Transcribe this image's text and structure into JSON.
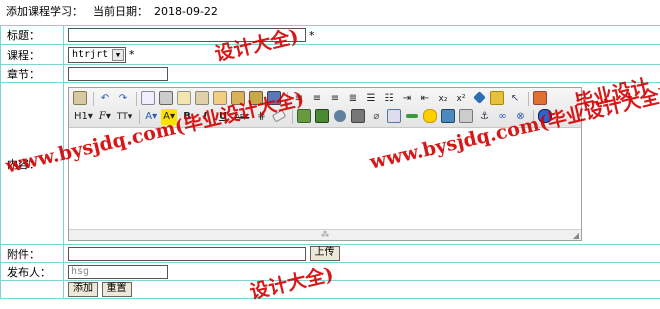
{
  "header": {
    "title": "添加课程学习：",
    "date_label": "当前日期：",
    "date_value": "2018-09-22"
  },
  "form": {
    "title": {
      "label": "标题：",
      "value": "",
      "required_mark": "*"
    },
    "course": {
      "label": "课程：",
      "selected": "htrjrt",
      "required_mark": "*"
    },
    "chapter": {
      "label": "章节：",
      "value": ""
    },
    "content": {
      "label": "内容："
    },
    "attachment": {
      "label": "附件：",
      "value": "",
      "upload_label": "上传"
    },
    "publisher": {
      "label": "发布人：",
      "value": "hsg"
    },
    "submit_label": "添加",
    "reset_label": "重置"
  },
  "editor": {
    "toolbar_row1": [
      "source-icon",
      "undo-icon",
      "redo-icon",
      "preview-icon",
      "print-icon",
      "template-icon",
      "cut-icon",
      "copy-icon",
      "paste-icon",
      "paste-text-icon",
      "paste-word-icon",
      "align-left-icon",
      "align-center-icon",
      "align-right-icon",
      "align-justify-icon",
      "ordered-list-icon",
      "unordered-list-icon",
      "indent-icon",
      "outdent-icon",
      "subscript-icon",
      "superscript-icon",
      "clear-format-icon",
      "select-all-icon",
      "fullscreen-icon",
      "help-icon"
    ],
    "toolbar_row2_text": {
      "heading": "H1",
      "font": "F",
      "size": "TT",
      "forecolor": "A",
      "hilite": "A",
      "bold": "B",
      "italic": "I",
      "underline": "U",
      "strike": "ABC"
    },
    "resize_glyph": "⁂",
    "grip_glyph": "◢"
  },
  "watermarks": [
    {
      "text": "www.bysjdq.com(毕业设计大全)"
    },
    {
      "text": "www.bysjdq.com(毕业设计大全)"
    },
    {
      "text": "设计大全)"
    },
    {
      "text": "毕业设计"
    },
    {
      "text": "设计大全)"
    }
  ],
  "colors": {
    "table_border": "#7fd3d3",
    "watermark": "#d40000",
    "toolbar_bg": "#e8e8e8"
  }
}
